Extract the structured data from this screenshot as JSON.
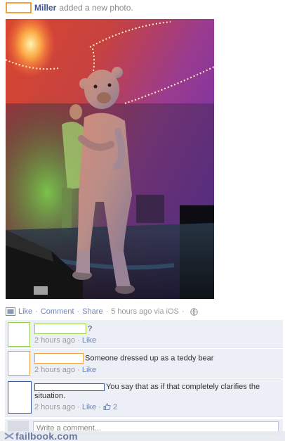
{
  "post": {
    "author": "Miller",
    "action": "added a new photo."
  },
  "actions_bar": {
    "like": "Like",
    "comment": "Comment",
    "share": "Share",
    "separator": "·",
    "time": "5 hours ago via iOS"
  },
  "comments": [
    {
      "text": "?",
      "time": "2 hours ago",
      "like": "Like",
      "name_redaction_color": "#9ad04a"
    },
    {
      "text": "Someone dressed up as a teddy bear",
      "time": "2 hours ago",
      "like": "Like",
      "name_redaction_color": "#f2a23a"
    },
    {
      "text": "You say that as if that completely clarifies the situation.",
      "time": "2 hours ago",
      "like": "Like",
      "likes_count": "2",
      "name_redaction_color": "#3b5998"
    }
  ],
  "write_comment": {
    "placeholder": "Write a comment..."
  },
  "watermark": {
    "text": "failbook.com"
  },
  "icons": [
    "photo-icon",
    "globe-icon",
    "thumbs-up-icon",
    "failbook-logo-icon"
  ],
  "colors": {
    "link": "#6d84b4",
    "name": "#3b5998",
    "comment_bg": "#eceff5",
    "muted": "#999999"
  }
}
